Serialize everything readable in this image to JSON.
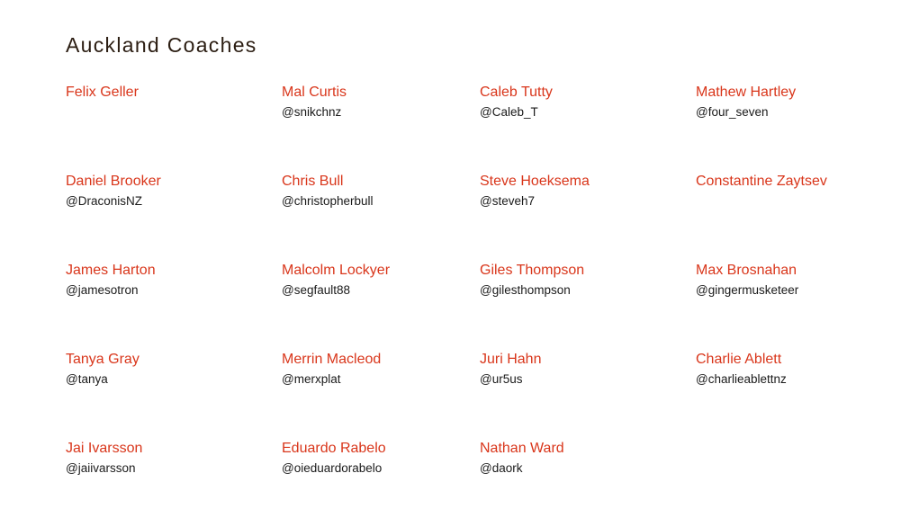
{
  "page": {
    "title": "Auckland Coaches"
  },
  "colors": {
    "name_link": "#d9361b",
    "handle_text": "#1a1a1a",
    "title_text": "#2b1d12",
    "background": "#ffffff"
  },
  "coaches": [
    {
      "name": "Felix Geller",
      "handle": ""
    },
    {
      "name": "Mal Curtis",
      "handle": "@snikchnz"
    },
    {
      "name": "Caleb Tutty",
      "handle": "@Caleb_T"
    },
    {
      "name": "Mathew Hartley",
      "handle": "@four_seven"
    },
    {
      "name": "Daniel Brooker",
      "handle": "@DraconisNZ"
    },
    {
      "name": "Chris Bull",
      "handle": "@christopherbull"
    },
    {
      "name": "Steve Hoeksema",
      "handle": "@steveh7"
    },
    {
      "name": "Constantine Zaytsev",
      "handle": ""
    },
    {
      "name": "James Harton",
      "handle": "@jamesotron"
    },
    {
      "name": "Malcolm Lockyer",
      "handle": "@segfault88"
    },
    {
      "name": "Giles Thompson",
      "handle": "@gilesthompson"
    },
    {
      "name": "Max Brosnahan",
      "handle": "@gingermusketeer"
    },
    {
      "name": "Tanya Gray",
      "handle": "@tanya"
    },
    {
      "name": "Merrin Macleod",
      "handle": "@merxplat"
    },
    {
      "name": "Juri Hahn",
      "handle": "@ur5us"
    },
    {
      "name": "Charlie Ablett",
      "handle": "@charlieablettnz"
    },
    {
      "name": "Jai Ivarsson",
      "handle": "@jaiivarsson"
    },
    {
      "name": "Eduardo Rabelo",
      "handle": "@oieduardorabelo"
    },
    {
      "name": "Nathan Ward",
      "handle": "@daork"
    }
  ]
}
